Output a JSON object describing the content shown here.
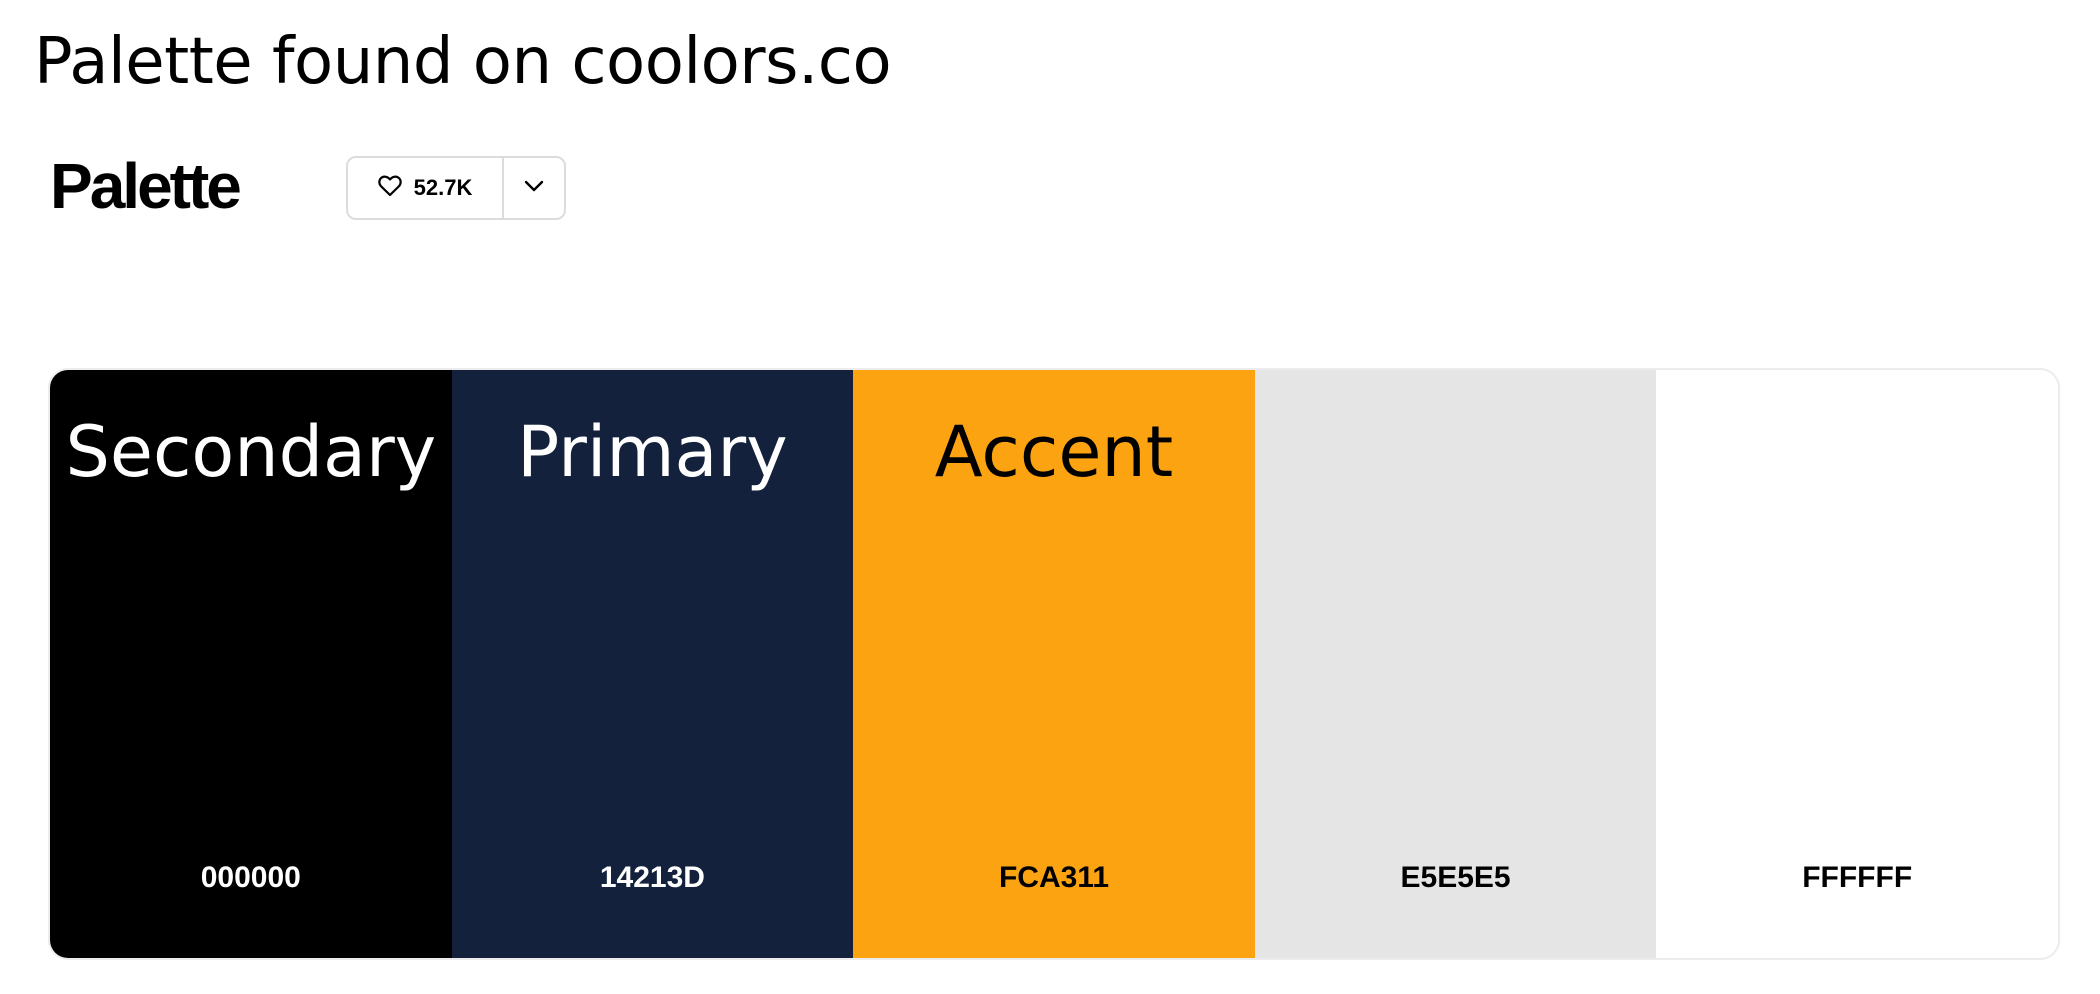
{
  "heading": "Palette found on coolors.co",
  "brand": "Palette",
  "likes": {
    "count": "52.7K",
    "icon": "heart-icon",
    "menu_icon": "chevron-down-icon"
  },
  "swatches": [
    {
      "name": "Secondary",
      "hex": "000000",
      "color": "#000000",
      "text_color": "#ffffff"
    },
    {
      "name": "Primary",
      "hex": "14213D",
      "color": "#14213D",
      "text_color": "#ffffff"
    },
    {
      "name": "Accent",
      "hex": "FCA311",
      "color": "#FCA311",
      "text_color": "#000000"
    },
    {
      "name": "",
      "hex": "E5E5E5",
      "color": "#E5E5E5",
      "text_color": "#000000"
    },
    {
      "name": "",
      "hex": "FFFFFF",
      "color": "#FFFFFF",
      "text_color": "#000000"
    }
  ]
}
